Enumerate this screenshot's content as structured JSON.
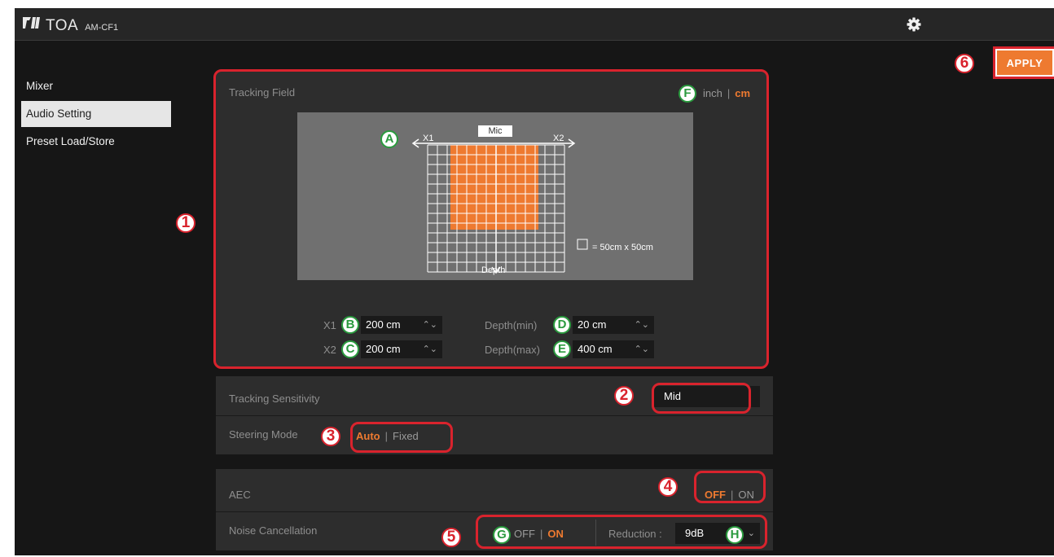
{
  "header": {
    "brand": "TOA",
    "model": "AM-CF1"
  },
  "apply_label": "APPLY",
  "sidebar": {
    "items": [
      "Mixer",
      "Audio Setting",
      "Preset Load/Store"
    ],
    "active": "Audio Setting"
  },
  "tracking_field": {
    "title": "Tracking Field",
    "units": [
      "inch",
      "cm"
    ],
    "selected_unit": "cm",
    "mic_label": "Mic",
    "x1_axis": "X1",
    "x2_axis": "X2",
    "depth_axis": "Depth",
    "legend": "= 50cm x 50cm",
    "x1_label": "X1",
    "x1_value": "200 cm",
    "x2_label": "X2",
    "x2_value": "200 cm",
    "depth_min_label": "Depth(min)",
    "depth_min_value": "20 cm",
    "depth_max_label": "Depth(max)",
    "depth_max_value": "400 cm"
  },
  "tracking_sensitivity": {
    "label": "Tracking Sensitivity",
    "value": "Mid"
  },
  "steering_mode": {
    "label": "Steering Mode",
    "options": [
      "Auto",
      "Fixed"
    ],
    "selected": "Auto"
  },
  "aec": {
    "label": "AEC",
    "options": [
      "OFF",
      "ON"
    ],
    "selected": "OFF"
  },
  "noise_cancellation": {
    "label": "Noise Cancellation",
    "options": [
      "OFF",
      "ON"
    ],
    "selected": "ON",
    "reduction_label": "Reduction :",
    "reduction_value": "9dB"
  },
  "callouts": {
    "numbers": [
      "1",
      "2",
      "3",
      "4",
      "5",
      "6"
    ],
    "letters": [
      "A",
      "B",
      "C",
      "D",
      "E",
      "F",
      "G",
      "H"
    ]
  },
  "colors": {
    "accent": "#ee7a30",
    "callout_red": "#d9232d",
    "callout_green": "#2a9a3e",
    "panel": "#2d2d2d",
    "background": "#161616"
  }
}
